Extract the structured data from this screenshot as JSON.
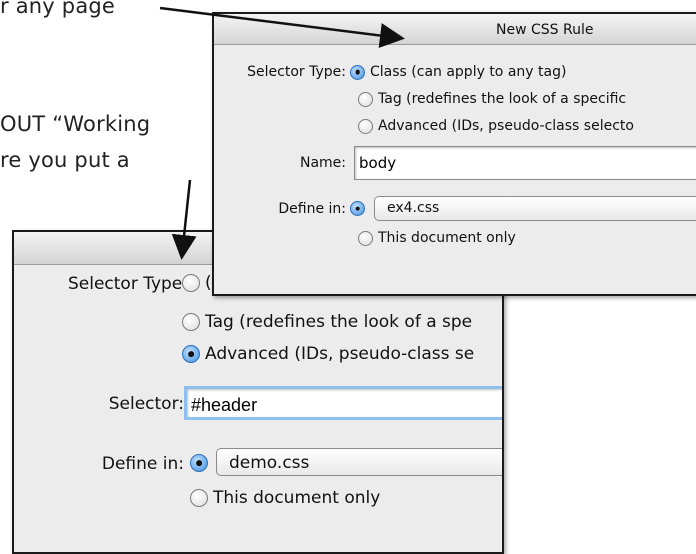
{
  "captions": {
    "line1": "r any page",
    "line2": "OUT “Working",
    "line3": "re you put a"
  },
  "back_dialog": {
    "selector_type_label": "Selector Type:",
    "options": [
      {
        "label": "(",
        "selected": false
      },
      {
        "label": "Tag (redefines the look of a spe",
        "selected": false
      },
      {
        "label": "Advanced (IDs, pseudo-class se",
        "selected": true
      }
    ],
    "selector_label": "Selector:",
    "selector_value": "#header",
    "define_in_label": "Define in:",
    "define_in_file": "demo.css",
    "define_in_file_selected": true,
    "this_document_only": "This document only",
    "this_document_only_selected": false
  },
  "front_dialog": {
    "title": "New CSS Rule",
    "selector_type_label": "Selector Type:",
    "options": [
      {
        "label": "Class (can apply to any tag)",
        "selected": true
      },
      {
        "label": "Tag (redefines the look of a specific",
        "selected": false
      },
      {
        "label": "Advanced (IDs, pseudo-class selecto",
        "selected": false
      }
    ],
    "name_label": "Name:",
    "name_value": "body",
    "define_in_label": "Define in:",
    "define_in_file": "ex4.css",
    "define_in_file_selected": true,
    "this_document_only": "This document only",
    "this_document_only_selected": false
  },
  "colors": {
    "dialog_bg": "#ececec",
    "selection_highlight": "#b5d5ff",
    "radio_selected": "#3f8fe0"
  }
}
